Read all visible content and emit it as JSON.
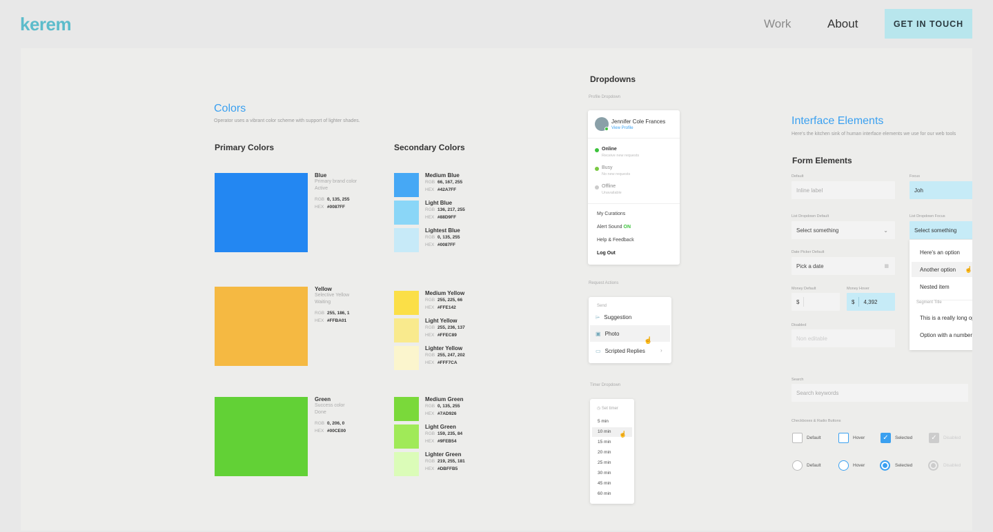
{
  "header": {
    "logo": "kerem",
    "nav": [
      "Work",
      "About"
    ],
    "cta": "GET IN TOUCH"
  },
  "colors": {
    "title": "Colors",
    "subtitle": "Operator uses a vibrant color scheme with support of lighter shades.",
    "primary_heading": "Primary Colors",
    "secondary_heading": "Secondary Colors",
    "primary": [
      {
        "name": "Blue",
        "desc1": "Primary brand color",
        "desc2": "Active",
        "rgb": "0, 135, 255",
        "hex": "#0087FF",
        "color": "#2387f2"
      },
      {
        "name": "Yellow",
        "desc1": "Selective Yellow",
        "desc2": "Waiting",
        "rgb": "255, 186, 1",
        "hex": "#FFBA01",
        "color": "#f5b942"
      },
      {
        "name": "Green",
        "desc1": "Success color",
        "desc2": "Done",
        "rgb": "0, 206, 0",
        "hex": "#00CE00",
        "color": "#62d136"
      }
    ],
    "secondary": [
      {
        "name": "Medium Blue",
        "rgb": "66, 167, 255",
        "hex": "#42A7FF",
        "color": "#46a8f5"
      },
      {
        "name": "Light Blue",
        "rgb": "136, 217, 255",
        "hex": "#88D9FF",
        "color": "#8ad6f7"
      },
      {
        "name": "Lightest Blue",
        "rgb": "0, 135, 255",
        "hex": "#0087FF",
        "color": "#c7eaf8"
      },
      {
        "name": "Medium Yellow",
        "rgb": "255, 225, 66",
        "hex": "#FFE142",
        "color": "#fbdf47"
      },
      {
        "name": "Light Yellow",
        "rgb": "255, 236, 137",
        "hex": "#FFEC89",
        "color": "#f9ea8d"
      },
      {
        "name": "Lighter Yellow",
        "rgb": "255, 247, 202",
        "hex": "#FFF7CA",
        "color": "#fbf5cd"
      },
      {
        "name": "Medium Green",
        "rgb": "0, 135, 255",
        "hex": "#7AD926",
        "color": "#7ad93a"
      },
      {
        "name": "Light Green",
        "rgb": "159, 235, 84",
        "hex": "#9FEB54",
        "color": "#a0ea58"
      },
      {
        "name": "Lighter Green",
        "rgb": "219, 255, 181",
        "hex": "#DBFFB5",
        "color": "#dbfcb8"
      }
    ],
    "labels": {
      "rgb": "RGB",
      "hex": "HEX"
    }
  },
  "dropdowns": {
    "title": "Dropdowns",
    "profile_label": "Profile Dropdown",
    "user_name": "Jennifer Cole Frances",
    "view_profile": "View Profile",
    "statuses": [
      {
        "label": "Online",
        "sub": "Receive new requests",
        "color": "#3cc23c"
      },
      {
        "label": "Busy",
        "sub": "No new requests",
        "color": "#7ac943"
      },
      {
        "label": "Offline",
        "sub": "Unavailable",
        "color": "#cccccc"
      }
    ],
    "menu": [
      "My Curations",
      "Alert Sound",
      "Help & Feedback",
      "Log Out"
    ],
    "alert_on": "ON",
    "request_label": "Request Actions",
    "send": "Send",
    "actions": [
      "Suggestion",
      "Photo",
      "Scripted Replies"
    ],
    "timer_label": "Timer Dropdown",
    "set_timer": "Set timer",
    "timers": [
      "5 min",
      "10 min",
      "15 min",
      "20 min",
      "25 min",
      "30 min",
      "45 min",
      "60 min"
    ]
  },
  "interface": {
    "title": "Interface Elements",
    "subtitle": "Here's the kitchen sink of human interface elements we use for our web tools",
    "form_heading": "Form Elements",
    "default_label": "Default",
    "default_placeholder": "Inline label",
    "focus_label": "Focus",
    "focus_value": "Joh",
    "list_default_label": "List Dropdown Default",
    "list_default_value": "Select something",
    "list_focus_label": "List Dropdown Focus",
    "list_focus_value": "Select something",
    "options": [
      "Here's an option",
      "Another option",
      "Nested item"
    ],
    "segment_title": "Segment Title",
    "options2": [
      "This is a really long option",
      "Option with a number"
    ],
    "date_label": "Date Picker Default",
    "date_placeholder": "Pick a date",
    "money_default_label": "Money Default",
    "money_hover_label": "Money Hover",
    "currency": "$",
    "money_value": "4,392",
    "disabled_label": "Disabled",
    "disabled_placeholder": "Non editable",
    "search_label": "Search",
    "search_placeholder": "Search keywords",
    "cb_label": "Checkboxes & Radio Buttons",
    "states": [
      "Default",
      "Hover",
      "Selected",
      "Disabled"
    ]
  }
}
